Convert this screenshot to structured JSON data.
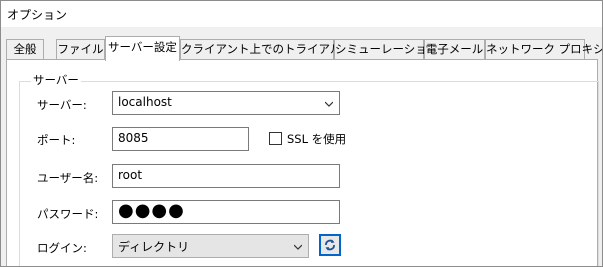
{
  "window": {
    "title": "オプション"
  },
  "tabs": [
    {
      "label": "全般"
    },
    {
      "label": "ファイル"
    },
    {
      "label": "サーバー設定",
      "active": true
    },
    {
      "label": "クライアント上でのトライアルラン"
    },
    {
      "label": "シミューレーション"
    },
    {
      "label": "電子メール"
    },
    {
      "label": "ネットワーク プロキシ"
    }
  ],
  "group": {
    "legend": "サーバー"
  },
  "form": {
    "server_label": "サーバー:",
    "server_value": "localhost",
    "port_label": "ポート:",
    "port_value": "8085",
    "ssl_label": "SSL を使用",
    "ssl_checked": false,
    "user_label": "ユーザー名:",
    "user_value": "root",
    "password_label": "パスワード:",
    "password_mask": "●●●●",
    "login_label": "ログイン:",
    "login_value": "ディレクトリ"
  },
  "icons": {
    "dropdown": "chevron-down-icon",
    "refresh": "refresh-icon"
  },
  "colors": {
    "focus_border": "#0066cc",
    "disabled_field": "#e5e5e5"
  }
}
